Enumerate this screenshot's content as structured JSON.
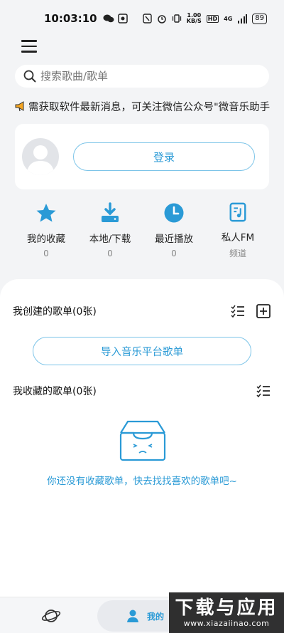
{
  "status_bar": {
    "time": "10:03:10",
    "speed_top": "1.00",
    "speed_bottom": "KB/S",
    "hd": "HD",
    "network": "4G",
    "battery": "89"
  },
  "search": {
    "placeholder": "搜索歌曲/歌单"
  },
  "notice": {
    "text": "需获取软件最新消息，可关注微信公众号\"微音乐助手\""
  },
  "login": {
    "button_label": "登录"
  },
  "quick_links": [
    {
      "label": "我的收藏",
      "count": "0",
      "icon": "star-icon"
    },
    {
      "label": "本地/下载",
      "count": "0",
      "icon": "download-icon"
    },
    {
      "label": "最近播放",
      "count": "0",
      "icon": "clock-icon"
    },
    {
      "label": "私人FM",
      "count": "频道",
      "icon": "music-note-icon"
    }
  ],
  "created_playlists": {
    "title": "我创建的歌单(0张)",
    "import_label": "导入音乐平台歌单"
  },
  "collected_playlists": {
    "title": "我收藏的歌单(0张)",
    "empty_text": "你还没有收藏歌单，快去找找喜欢的歌单吧~"
  },
  "bottom_nav": {
    "mine_label": "我的"
  },
  "watermark": {
    "big": "下载与应用",
    "small": "www.xiazaiinao.com"
  },
  "colors": {
    "accent": "#2a9ad6",
    "accent_border": "#7cc4e8",
    "background": "#f3f4f6"
  }
}
